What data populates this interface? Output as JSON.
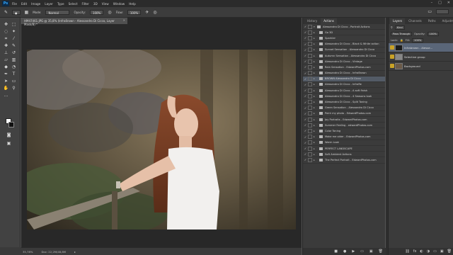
{
  "app": {
    "logo": "Ps"
  },
  "menu": [
    "File",
    "Edit",
    "Image",
    "Layer",
    "Type",
    "Select",
    "Filter",
    "3D",
    "View",
    "Window",
    "Help"
  ],
  "window_controls": [
    "–",
    "□",
    "✕"
  ],
  "options_bar": {
    "mode_label": "Mode:",
    "mode_value": "Normal",
    "opacity_label": "Opacity:",
    "opacity_value": "100%",
    "flow_label": "Flow:",
    "flow_value": "100%"
  },
  "document": {
    "tab_title": "HM47461.JPG @ 35,8% (Infraßrown - Alessandro Di Cicco, Layer Mask/8) *",
    "close": "✕",
    "zoom": "35,78%",
    "doc_size": "Doc: 22,2M/48,8M"
  },
  "actions_panel": {
    "tabs": [
      "History",
      "Actions"
    ],
    "active_tab": "Actions",
    "items": [
      {
        "label": "Alessandro Di Cicco - Portrait Actions",
        "indent": 0,
        "selected": false
      },
      {
        "label": "Go 3D",
        "indent": 1,
        "selected": false
      },
      {
        "label": "Sparkler",
        "indent": 1,
        "selected": false
      },
      {
        "label": "Alessandro Di Cicco - Black & White action",
        "indent": 1,
        "selected": false
      },
      {
        "label": "Sunset Sensation - Alessandro Di Cicco",
        "indent": 1,
        "selected": false
      },
      {
        "label": "Autumn Sensation - Alessandro Di Cicco",
        "indent": 1,
        "selected": false
      },
      {
        "label": "Alessandro Di Cicco - Vintage",
        "indent": 1,
        "selected": false
      },
      {
        "label": "Rain Sensation - EdwardPhotos.com",
        "indent": 1,
        "selected": false
      },
      {
        "label": "Alessandro Di Cicco - InfraBrown",
        "indent": 1,
        "selected": false
      },
      {
        "label": "BROWN Alessandro Di Cicco",
        "indent": 1,
        "selected": true
      },
      {
        "label": "Alessandro Di Cicco - InfraRe",
        "indent": 1,
        "selected": false
      },
      {
        "label": "Alessandro Di Cicco - A soft finish",
        "indent": 1,
        "selected": false
      },
      {
        "label": "Alessandro Di Cicco - 4 Seasons look",
        "indent": 1,
        "selected": false
      },
      {
        "label": "Alessandro Di Cicco - Split Toning",
        "indent": 1,
        "selected": false
      },
      {
        "label": "Green Sensation - Alessandro Di Cicco",
        "indent": 1,
        "selected": false
      },
      {
        "label": "Point my photo - EdwardPhotos.com",
        "indent": 1,
        "selected": false
      },
      {
        "label": "Joy Portraits - EdwardPhotos.com",
        "indent": 1,
        "selected": false
      },
      {
        "label": "Summer Feeling - edwardPhotos.com",
        "indent": 1,
        "selected": false
      },
      {
        "label": "Color Toning",
        "indent": 1,
        "selected": false
      },
      {
        "label": "Make me older - EdwardPhotos.com",
        "indent": 1,
        "selected": false
      },
      {
        "label": "Warm Look",
        "indent": 1,
        "selected": false
      },
      {
        "label": "PERFECT LANDSCAPE",
        "indent": 1,
        "selected": false
      },
      {
        "label": "Soft Ambient Actions",
        "indent": 1,
        "selected": false
      },
      {
        "label": "The Perfect Portrait - EdwardPhotos.com",
        "indent": 1,
        "selected": false
      }
    ],
    "bottom_controls": [
      "■",
      "●",
      "▶",
      "▭",
      "▣",
      "🗑"
    ]
  },
  "layers_panel": {
    "tabs": [
      "Layers",
      "Channels",
      "Paths",
      "Adjustments"
    ],
    "active_tab": "Layers",
    "kind_label": "Kind",
    "blend_mode": "Pass Through",
    "opacity_label": "Opacity:",
    "opacity_value": "100%",
    "lock_label": "Lock:",
    "fill_label": "Fill:",
    "fill_value": "100%",
    "layers": [
      {
        "name": "Infrabrown - Alesse...",
        "selected": true,
        "visible": true,
        "thumb_color": "#1c1c1c"
      },
      {
        "name": "Selective group",
        "selected": false,
        "visible": true,
        "thumb_color": "#888888"
      },
      {
        "name": "Background",
        "selected": false,
        "visible": true,
        "thumb_color": "#6b5a48"
      }
    ],
    "bottom_controls": [
      "⛓",
      "fx",
      "◐",
      "◑",
      "▭",
      "▣",
      "🗑"
    ]
  },
  "colors": {
    "selection_blue": "#535b66",
    "layer_selected": "#5a6678",
    "visibility_yellow": "#c9a227"
  }
}
